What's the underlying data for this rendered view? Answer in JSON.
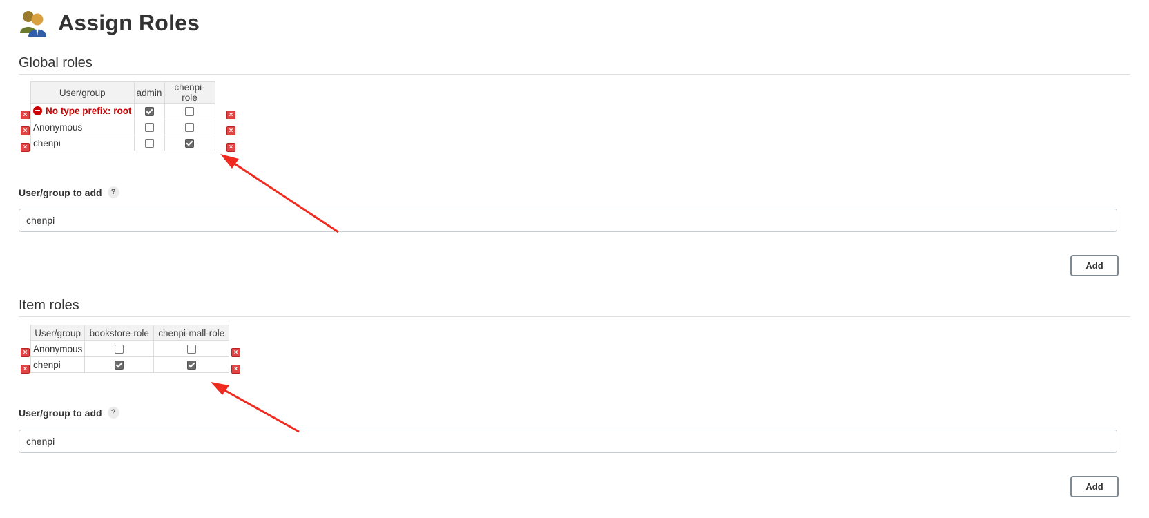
{
  "page": {
    "title": "Assign Roles",
    "icon": "user-group-icon"
  },
  "global": {
    "section_title": "Global roles",
    "columns": [
      "User/group",
      "admin",
      "chenpi-role"
    ],
    "warning_label": "No type prefix: root",
    "rows": [
      {
        "user": "No type prefix: root",
        "checks": [
          true,
          false
        ],
        "warning": true
      },
      {
        "user": "Anonymous",
        "checks": [
          false,
          false
        ]
      },
      {
        "user": "chenpi",
        "checks": [
          false,
          true
        ]
      }
    ],
    "add_label": "User/group to add",
    "help": "?",
    "input_value": "chenpi",
    "add_button": "Add"
  },
  "item": {
    "section_title": "Item roles",
    "columns": [
      "User/group",
      "bookstore-role",
      "chenpi-mall-role"
    ],
    "rows": [
      {
        "user": "Anonymous",
        "checks": [
          false,
          false
        ]
      },
      {
        "user": "chenpi",
        "checks": [
          true,
          true
        ]
      }
    ],
    "add_label": "User/group to add",
    "help": "?",
    "input_value": "chenpi",
    "add_button": "Add"
  },
  "annotations": {
    "arrow_color": "#f02a1e"
  },
  "colors": {
    "warning": "#cc0000",
    "remove": "#e04444"
  }
}
